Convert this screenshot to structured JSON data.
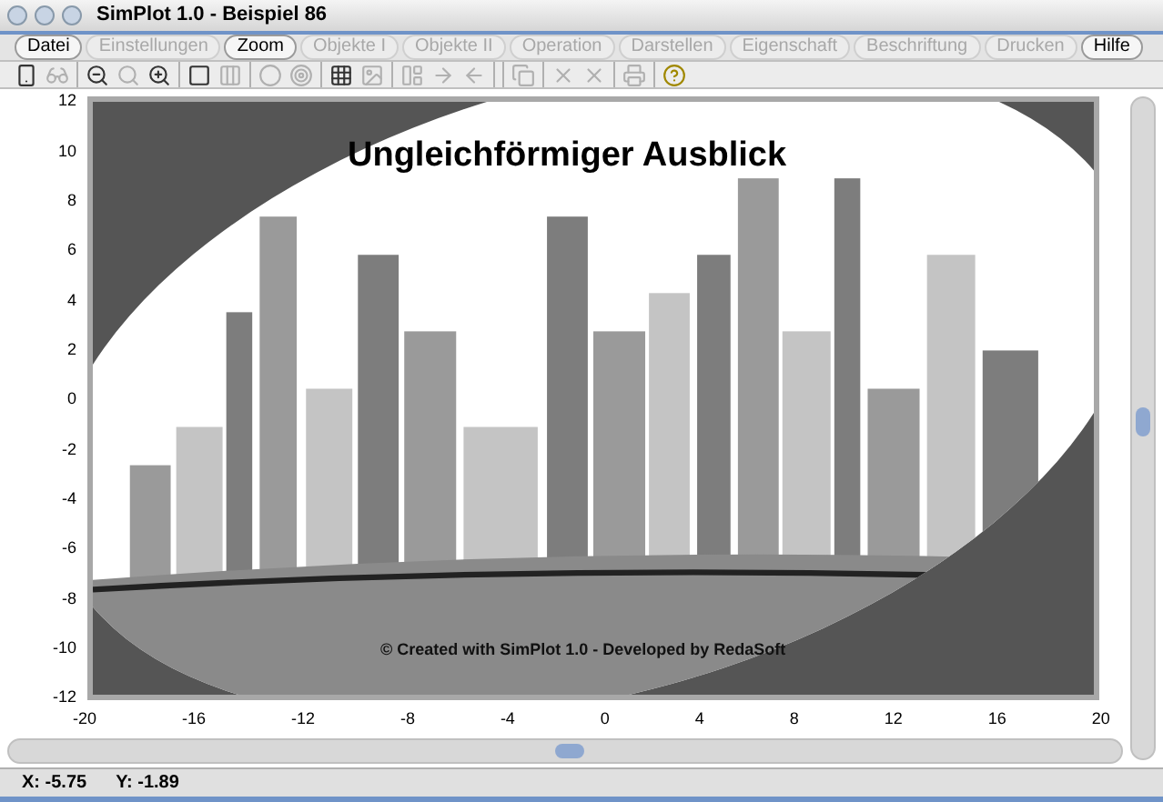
{
  "window": {
    "title": "SimPlot 1.0 - Beispiel 86"
  },
  "menu": [
    {
      "label": "Datei",
      "disabled": false
    },
    {
      "label": "Einstellungen",
      "disabled": true
    },
    {
      "label": "Zoom",
      "disabled": false
    },
    {
      "label": "Objekte I",
      "disabled": true
    },
    {
      "label": "Objekte II",
      "disabled": true
    },
    {
      "label": "Operation",
      "disabled": true
    },
    {
      "label": "Darstellen",
      "disabled": true
    },
    {
      "label": "Eigenschaft",
      "disabled": true
    },
    {
      "label": "Beschriftung",
      "disabled": true
    },
    {
      "label": "Drucken",
      "disabled": true
    },
    {
      "label": "Hilfe",
      "disabled": false
    }
  ],
  "toolbar": [
    {
      "kind": "device",
      "disabled": false
    },
    {
      "kind": "glasses",
      "disabled": true
    },
    {
      "kind": "sep"
    },
    {
      "kind": "zoom-out",
      "disabled": false
    },
    {
      "kind": "zoom",
      "disabled": true
    },
    {
      "kind": "zoom-in",
      "disabled": false
    },
    {
      "kind": "sep"
    },
    {
      "kind": "square",
      "disabled": false
    },
    {
      "kind": "columns",
      "disabled": true
    },
    {
      "kind": "sep"
    },
    {
      "kind": "circle",
      "disabled": true
    },
    {
      "kind": "target",
      "disabled": true
    },
    {
      "kind": "sep"
    },
    {
      "kind": "grid",
      "disabled": false
    },
    {
      "kind": "image",
      "disabled": true
    },
    {
      "kind": "sep"
    },
    {
      "kind": "layout",
      "disabled": true
    },
    {
      "kind": "arrow-right",
      "disabled": true
    },
    {
      "kind": "arrow-left",
      "disabled": true
    },
    {
      "kind": "sep"
    },
    {
      "kind": "sep"
    },
    {
      "kind": "copy",
      "disabled": true
    },
    {
      "kind": "sep"
    },
    {
      "kind": "x",
      "disabled": true
    },
    {
      "kind": "x2",
      "disabled": true
    },
    {
      "kind": "sep"
    },
    {
      "kind": "printer",
      "disabled": true
    },
    {
      "kind": "sep"
    },
    {
      "kind": "help",
      "disabled": false
    }
  ],
  "plot": {
    "title": "Ungleichförmiger Ausblick",
    "credit": "© Created with SimPlot 1.0 - Developed by RedaSoft",
    "yticks": [
      "12",
      "10",
      "8",
      "6",
      "4",
      "2",
      "0",
      "-2",
      "-4",
      "-6",
      "-8",
      "-10",
      "-12"
    ],
    "xticks": [
      "-20",
      "-16",
      "-12",
      "-8",
      "-4",
      "0",
      "4",
      "8",
      "12",
      "16",
      "20"
    ]
  },
  "status_bar": {
    "x": "X: -5.75",
    "y": "Y: -1.89"
  }
}
